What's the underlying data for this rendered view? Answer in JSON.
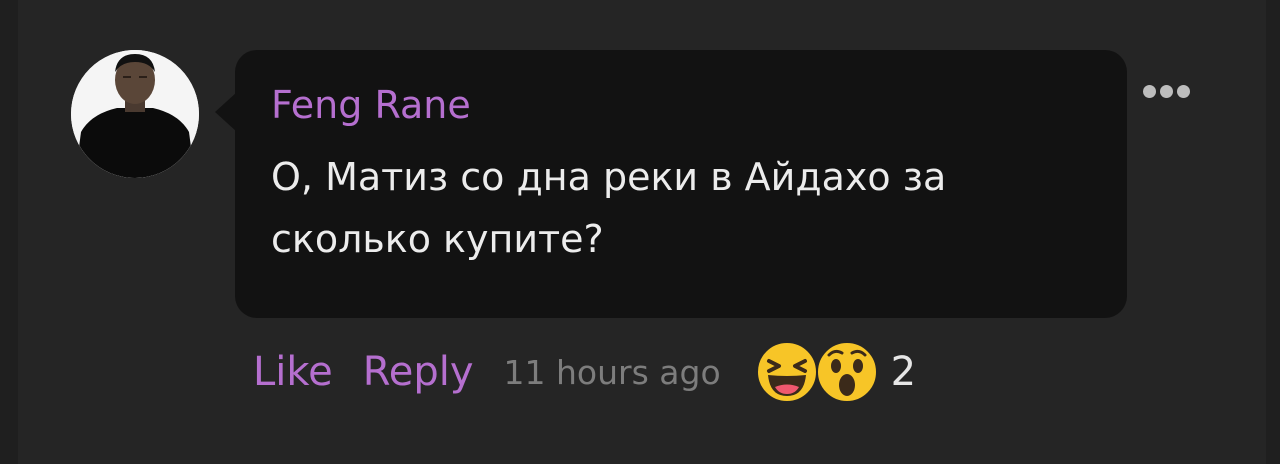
{
  "comment": {
    "author": "Feng Rane",
    "text": "О, Матиз со дна реки в Айдахо за сколько купите?",
    "avatar_icon": "user-avatar-photo",
    "more_icon": "more-horizontal-icon"
  },
  "actions": {
    "like_label": "Like",
    "reply_label": "Reply",
    "timestamp": "11 hours ago"
  },
  "reactions": {
    "icons": [
      "laughing-face-icon",
      "surprised-face-icon"
    ],
    "count": "2"
  },
  "colors": {
    "page_bg": "#1f1f1f",
    "card_bg": "#252525",
    "bubble_bg": "#121212",
    "accent": "#b56fcf",
    "muted": "#7d7d7d",
    "text": "#ececec",
    "emoji_yellow": "#f7c527"
  }
}
